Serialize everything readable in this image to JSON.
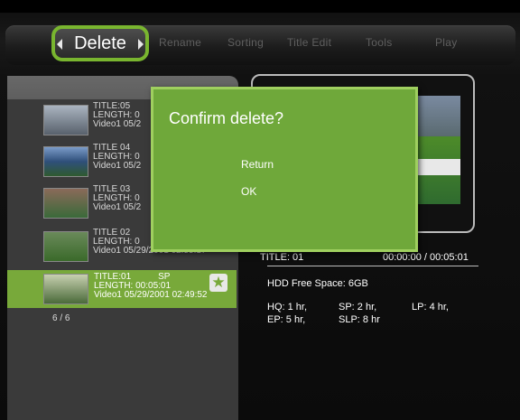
{
  "menu": {
    "active": "Delete",
    "items": [
      "Rename",
      "Sorting",
      "Title Edit",
      "Tools",
      "Play"
    ]
  },
  "titles": [
    {
      "line1": "TITLE:05",
      "line2": "LENGTH: 0",
      "line3": "Video1 05/2"
    },
    {
      "line1": "TITLE 04",
      "line2": "LENGTH: 0",
      "line3": "Video1 05/2"
    },
    {
      "line1": "TITLE 03",
      "line2": "LENGTH: 0",
      "line3": "Video1 05/2"
    },
    {
      "line1": "TITLE 02",
      "line2": "LENGTH: 0",
      "line3": "Video1 05/29/2001 02:55:17"
    }
  ],
  "selected": {
    "line1": "TITLE:01",
    "mode": "SP",
    "line2": "LENGTH: 00:05:01",
    "line3": "Video1 05/29/2001 02:49:52"
  },
  "count": "6 / 6",
  "preview": {
    "title": "TITLE: 01",
    "time": "00:00:00  /  00:05:01",
    "hdd": "HDD Free Space: 6GB",
    "hq": "HQ: 1 hr,",
    "sp": "SP: 2 hr,",
    "lp": "LP: 4 hr,",
    "ep": "EP: 5 hr,",
    "slp": "SLP: 8 hr"
  },
  "dialog": {
    "title": "Confirm delete?",
    "options": [
      "Return",
      "OK"
    ]
  },
  "colors": {
    "accent": "#78a93a",
    "dialog": "#6fa83a"
  }
}
